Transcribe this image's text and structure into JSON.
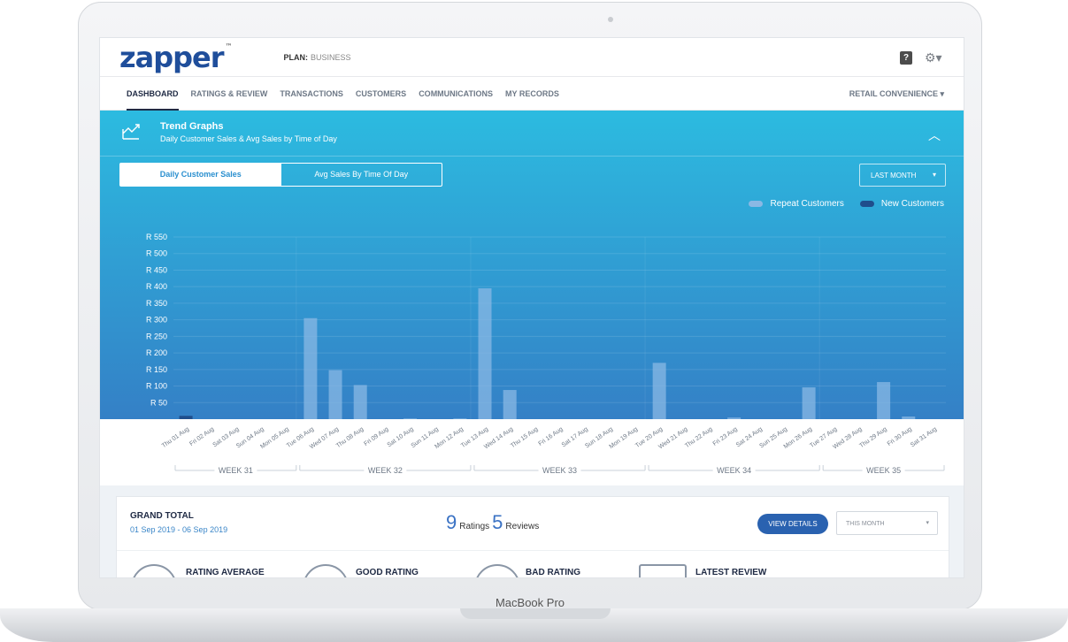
{
  "device_label": "MacBook Pro",
  "header": {
    "logo": "zapper",
    "logo_tm": "™",
    "plan_label": "PLAN:",
    "plan_value": "BUSINESS",
    "help_icon": "help-icon",
    "settings_icon": "gear-icon"
  },
  "nav": {
    "tabs": [
      "DASHBOARD",
      "RATINGS & REVIEW",
      "TRANSACTIONS",
      "CUSTOMERS",
      "COMMUNICATIONS",
      "MY RECORDS"
    ],
    "active": "DASHBOARD",
    "store": "RETAIL CONVENIENCE"
  },
  "panel": {
    "title": "Trend Graphs",
    "subtitle": "Daily Customer Sales & Avg Sales by Time of Day",
    "segments": [
      "Daily Customer Sales",
      "Avg Sales By Time Of Day"
    ],
    "active_segment": "Daily Customer Sales",
    "range": "LAST MONTH",
    "legend": [
      "Repeat Customers",
      "New Customers"
    ],
    "colors": {
      "repeat": "#8ab8e4",
      "new": "#1f4e8c"
    }
  },
  "chart_data": {
    "type": "bar",
    "categories": [
      "Thu 01 Aug",
      "Fri 02 Aug",
      "Sat 03 Aug",
      "Sun 04 Aug",
      "Mon 05 Aug",
      "Tue 06 Aug",
      "Wed 07 Aug",
      "Thu 08 Aug",
      "Fri 09 Aug",
      "Sat 10 Aug",
      "Sun 11 Aug",
      "Mon 12 Aug",
      "Tue 13 Aug",
      "Wed 14 Aug",
      "Thu 15 Aug",
      "Fri 16 Aug",
      "Sat 17 Aug",
      "Sun 18 Aug",
      "Mon 19 Aug",
      "Tue 20 Aug",
      "Wed 21 Aug",
      "Thu 22 Aug",
      "Fri 23 Aug",
      "Sat 24 Aug",
      "Sun 25 Aug",
      "Mon 26 Aug",
      "Tue 27 Aug",
      "Wed 28 Aug",
      "Thu 29 Aug",
      "Fri 30 Aug",
      "Sat 31 Aug"
    ],
    "series": [
      {
        "name": "Repeat Customers",
        "values": [
          0,
          0,
          0,
          0,
          0,
          305,
          148,
          103,
          0,
          2,
          0,
          2,
          395,
          88,
          0,
          0,
          0,
          0,
          0,
          170,
          0,
          0,
          5,
          0,
          0,
          96,
          0,
          0,
          112,
          8,
          0
        ]
      },
      {
        "name": "New Customers",
        "values": [
          10,
          0,
          0,
          0,
          0,
          0,
          0,
          0,
          0,
          0,
          0,
          0,
          0,
          0,
          0,
          0,
          0,
          0,
          0,
          0,
          0,
          0,
          0,
          0,
          0,
          0,
          0,
          0,
          0,
          0,
          0
        ]
      }
    ],
    "yticks": [
      "R 550",
      "R 500",
      "R 450",
      "R 400",
      "R 350",
      "R 300",
      "R 250",
      "R 200",
      "R 150",
      "R 100",
      "R 50"
    ],
    "ylim": [
      0,
      550
    ],
    "weeks": [
      "WEEK 31",
      "WEEK 32",
      "WEEK 33",
      "WEEK 34",
      "WEEK 35"
    ]
  },
  "summary": {
    "title": "GRAND TOTAL",
    "dates": "01 Sep 2019 - 06 Sep 2019",
    "ratings_count": "9",
    "ratings_label": "Ratings",
    "reviews_count": "5",
    "reviews_label": "Reviews",
    "view_details": "VIEW DETAILS",
    "period": "THIS MONTH",
    "stats": [
      "RATING AVERAGE",
      "GOOD RATING",
      "BAD RATING",
      "LATEST REVIEW"
    ]
  }
}
